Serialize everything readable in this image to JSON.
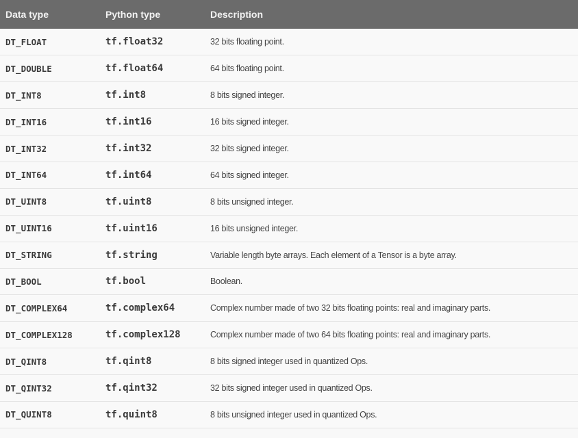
{
  "headers": [
    "Data type",
    "Python type",
    "Description"
  ],
  "rows": [
    [
      "DT_FLOAT",
      "tf.float32",
      "32 bits floating point."
    ],
    [
      "DT_DOUBLE",
      "tf.float64",
      "64 bits floating point."
    ],
    [
      "DT_INT8",
      "tf.int8",
      "8 bits signed integer."
    ],
    [
      "DT_INT16",
      "tf.int16",
      "16 bits signed integer."
    ],
    [
      "DT_INT32",
      "tf.int32",
      "32 bits signed integer."
    ],
    [
      "DT_INT64",
      "tf.int64",
      "64 bits signed integer."
    ],
    [
      "DT_UINT8",
      "tf.uint8",
      "8 bits unsigned integer."
    ],
    [
      "DT_UINT16",
      "tf.uint16",
      "16 bits unsigned integer."
    ],
    [
      "DT_STRING",
      "tf.string",
      "Variable length byte arrays. Each element of a Tensor is a byte array."
    ],
    [
      "DT_BOOL",
      "tf.bool",
      "Boolean."
    ],
    [
      "DT_COMPLEX64",
      "tf.complex64",
      "Complex number made of two 32 bits floating points: real and imaginary parts."
    ],
    [
      "DT_COMPLEX128",
      "tf.complex128",
      "Complex number made of two 64 bits floating points: real and imaginary parts."
    ],
    [
      "DT_QINT8",
      "tf.qint8",
      "8 bits signed integer used in quantized Ops."
    ],
    [
      "DT_QINT32",
      "tf.qint32",
      "32 bits signed integer used in quantized Ops."
    ],
    [
      "DT_QUINT8",
      "tf.quint8",
      "8 bits unsigned integer used in quantized Ops."
    ]
  ]
}
